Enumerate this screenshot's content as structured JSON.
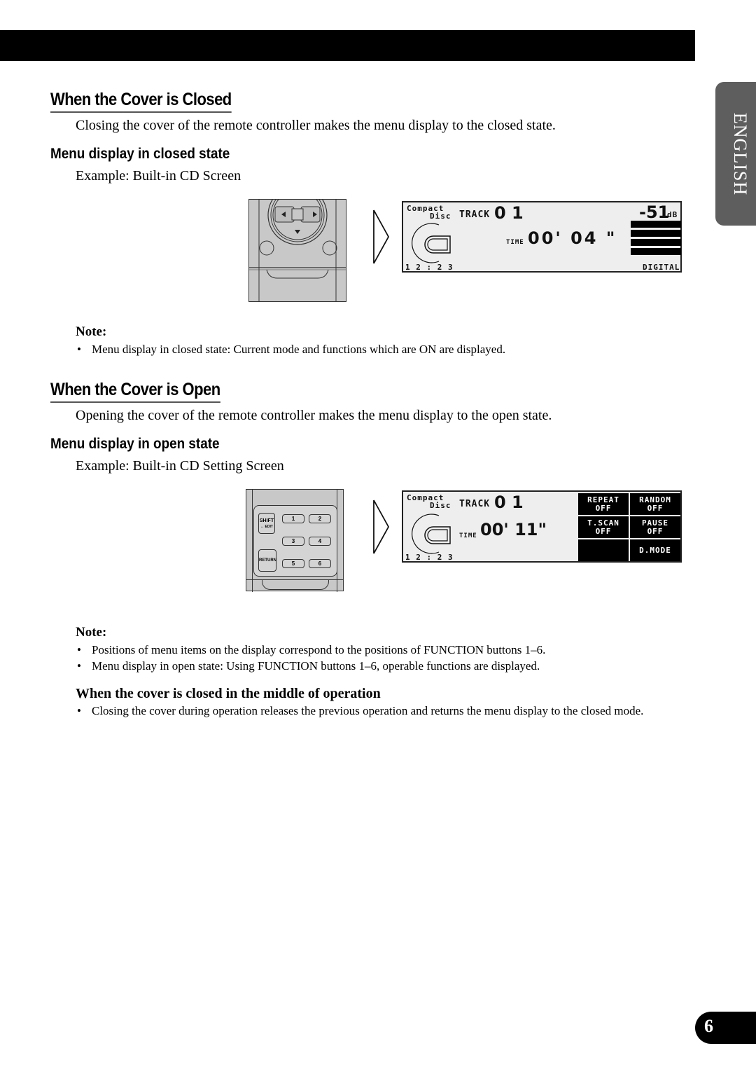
{
  "side_tab": {
    "label": "ENGLISH"
  },
  "section_closed": {
    "heading": "When the Cover is Closed",
    "intro": "Closing the cover of the remote controller makes the menu display to the closed state.",
    "subheading": "Menu display in closed state",
    "example": "Example: Built-in CD Screen",
    "note_title": "Note:",
    "notes": [
      "Menu display in closed state: Current mode and functions which are ON are displayed."
    ],
    "lcd": {
      "source_line1": "Compact",
      "source_line2": "Disc",
      "track_label": "TRACK",
      "track_number": "0 1",
      "volume": "-51",
      "volume_unit": "dB",
      "time_label": "TIME",
      "time_value": "00' 04 \"",
      "clock": "1 2 : 2 3",
      "mode": "DIGITAL"
    },
    "remote": {
      "icons": [
        "left-arrow",
        "right-arrow",
        "down-arrow"
      ]
    }
  },
  "section_open": {
    "heading": "When the Cover is Open",
    "intro": "Opening the cover of the remote controller makes the menu display to the open state.",
    "subheading": "Menu display in open state",
    "example": "Example: Built-in CD Setting Screen",
    "note_title": "Note:",
    "notes": [
      "Positions of menu items on the display correspond to the positions of FUNCTION buttons 1–6.",
      "Menu display in open state: Using FUNCTION buttons 1–6, operable functions are displayed."
    ],
    "lcd": {
      "source_line1": "Compact",
      "source_line2": "Disc",
      "track_label": "TRACK",
      "track_number": "0 1",
      "time_label": "TIME",
      "time_value": "00' 11\"",
      "clock": "1 2 : 2 3",
      "menu": [
        {
          "name": "REPEAT",
          "value": "OFF"
        },
        {
          "name": "RANDOM",
          "value": "OFF"
        },
        {
          "name": "T.SCAN",
          "value": "OFF"
        },
        {
          "name": "PAUSE",
          "value": "OFF"
        },
        {
          "name": "",
          "value": ""
        },
        {
          "name": "D.MODE",
          "value": ""
        }
      ]
    },
    "remote": {
      "shift_label": "SHIFT",
      "edit_label": "↔ EDIT",
      "return_label": "RETURN",
      "buttons": [
        "1",
        "2",
        "3",
        "4",
        "5",
        "6"
      ]
    }
  },
  "subsection_middle": {
    "heading": "When the cover is closed in the middle of operation",
    "bullets": [
      "Closing the cover during operation releases the previous operation and returns the menu display to the closed mode."
    ]
  },
  "page_number": "6"
}
